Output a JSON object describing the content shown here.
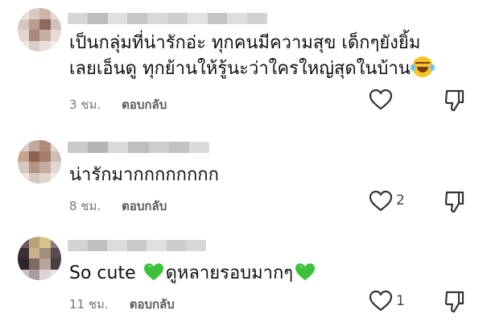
{
  "comments": [
    {
      "text_line1": "เป็นกลุ่มที่น่ารักอ่ะ ทุกคนมีความสุข เด็กๆยังยิ้ม",
      "text_line2": "เลยเอ็นดู ทุกย้านให้รู้นะว่าใครใหญ่สุดในบ้าน",
      "emoji": "face-with-tears-of-joy",
      "time": "3 ชม.",
      "reply_label": "ตอบกลับ",
      "like_count": ""
    },
    {
      "text_line1": "น่ารักมากกกกกกกก",
      "time": "8 ชม.",
      "reply_label": "ตอบกลับ",
      "like_count": "2"
    },
    {
      "text_part1": "So cute ",
      "emoji": "green-heart",
      "text_part2": "ดูหลายรอบมากๆ",
      "time": "11 ชม.",
      "reply_label": "ตอบกลับ",
      "like_count": "1"
    }
  ],
  "icons": {
    "like": "heart-outline-icon",
    "dislike": "thumbs-down-icon"
  },
  "colors": {
    "text": "#111111",
    "meta": "#777777",
    "green_heart": "#3cc13b",
    "laugh_face": "#f7c52b"
  }
}
